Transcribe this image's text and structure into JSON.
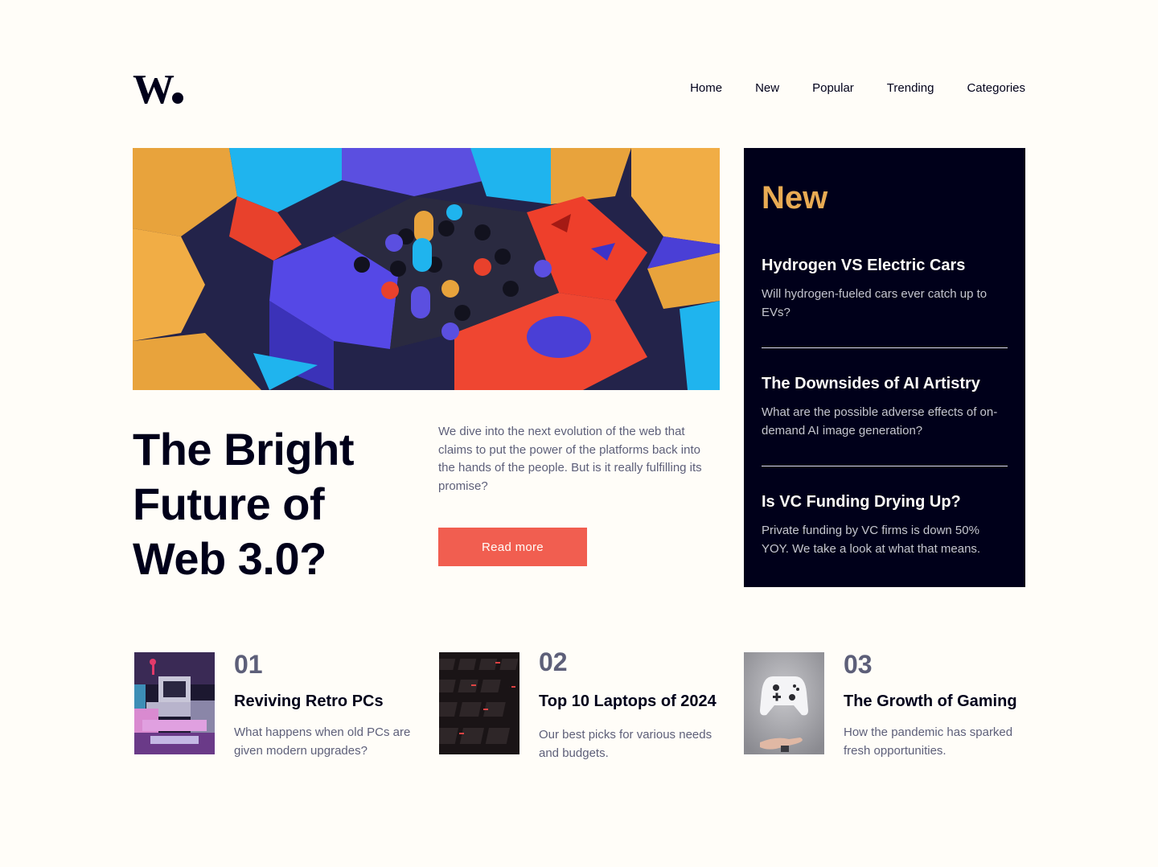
{
  "logo": {
    "text": "W."
  },
  "nav": [
    {
      "label": "Home"
    },
    {
      "label": "New"
    },
    {
      "label": "Popular"
    },
    {
      "label": "Trending"
    },
    {
      "label": "Categories"
    }
  ],
  "hero": {
    "title": "The Bright Future of Web 3.0?",
    "description": "We dive into the next evolution of the web that claims to put the power of the platforms back into the hands of the people. But is it really fulfilling its promise?",
    "button": "Read more"
  },
  "new_panel": {
    "heading": "New",
    "items": [
      {
        "title": "Hydrogen VS Electric Cars",
        "description": "Will hydrogen-fueled cars ever catch up to EVs?"
      },
      {
        "title": "The Downsides of AI Artistry",
        "description": "What are the possible adverse effects of on-demand AI image generation?"
      },
      {
        "title": "Is VC Funding Drying Up?",
        "description": "Private funding by VC firms is down 50% YOY. We take a look at what that means."
      }
    ]
  },
  "cards": [
    {
      "number": "01",
      "title": "Reviving Retro PCs",
      "description": "What happens when old PCs are given modern upgrades?"
    },
    {
      "number": "02",
      "title": "Top 10 Laptops of 2024",
      "description": "Our best picks for various needs and budgets."
    },
    {
      "number": "03",
      "title": "The Growth of Gaming",
      "description": "How the pandemic has sparked fresh opportunities."
    }
  ],
  "colors": {
    "background": "#fffdf8",
    "dark": "#00001a",
    "accent_red": "#f15e50",
    "accent_orange": "#e9ab53",
    "muted": "#5d5f79"
  }
}
